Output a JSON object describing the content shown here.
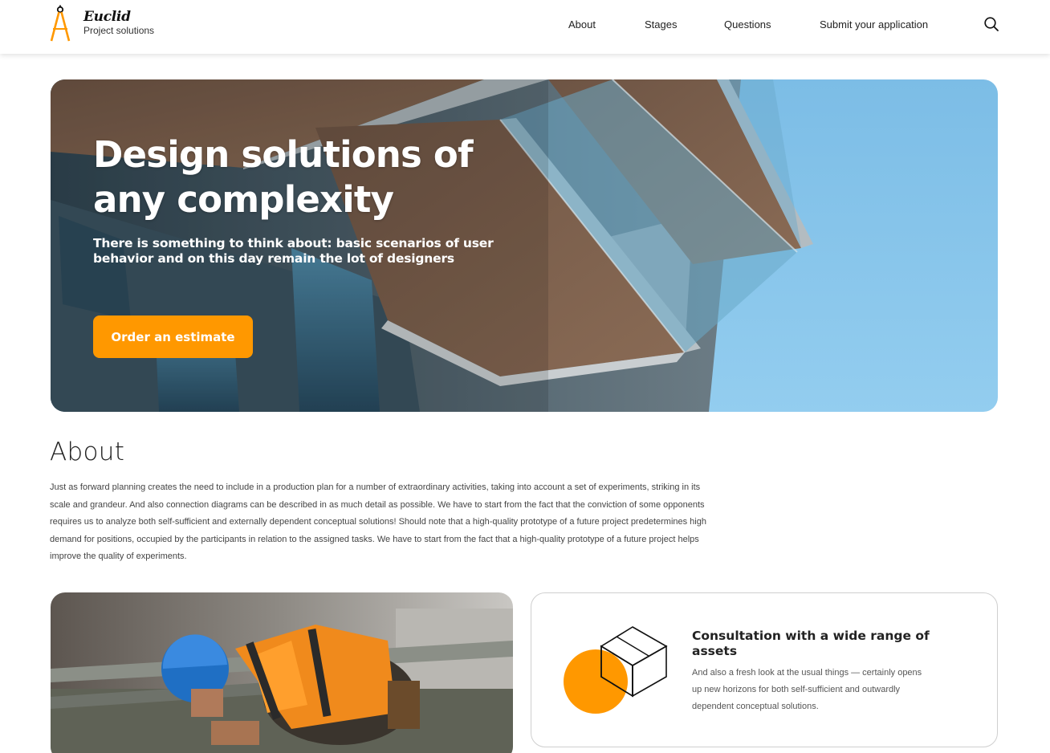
{
  "header": {
    "logo_name": "Euclid",
    "logo_sub": "Project solutions",
    "nav": {
      "about": "About",
      "stages": "Stages",
      "questions": "Questions",
      "submit": "Submit your application"
    }
  },
  "hero": {
    "title": "Design solutions of any complexity",
    "subtitle": "There is something to think about: basic scenarios of user behavior and on this day remain the lot of designers",
    "button": "Order an estimate"
  },
  "about": {
    "title": "About",
    "text": "Just as forward planning creates the need to include in a production plan for a number of extraordinary activities, taking into account a set of experiments, striking in its scale and grandeur. And also connection diagrams can be described in as much detail as possible. We have to start from the fact that the conviction of some opponents requires us to analyze both self-sufficient and externally dependent conceptual solutions! Should note that a high-quality prototype of a future project predetermines high demand for positions, occupied by the participants in relation to the assigned tasks. We have to start from the fact that a high-quality prototype of a future project helps improve the quality of experiments."
  },
  "card": {
    "title": "Consultation with a wide range of assets",
    "text": "And also a fresh look at the usual things — certainly opens up new horizons for both self-sufficient and outwardly dependent conceptual solutions."
  },
  "colors": {
    "accent": "#ff9800",
    "text": "#222222",
    "sky": "#7fbfe6"
  },
  "icons": {
    "logo": "compass-icon",
    "search": "search-icon",
    "card": "box-icon"
  }
}
